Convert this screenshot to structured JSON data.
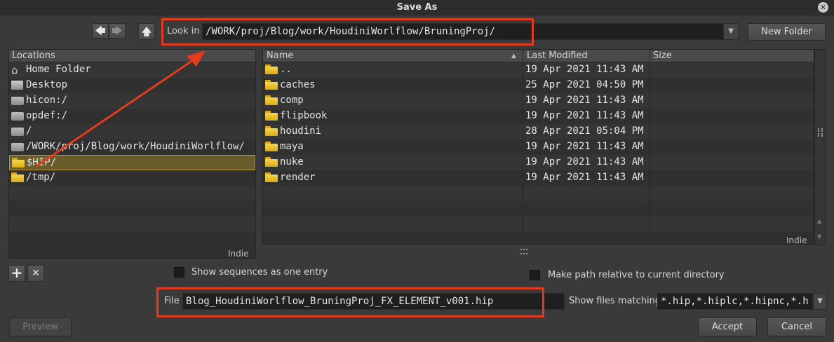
{
  "window": {
    "title": "Save As"
  },
  "toolbar": {
    "lookin_label": "Look in",
    "path": "/WORK/proj/Blog/work/HoudiniWorlflow/BruningProj/",
    "new_folder_label": "New Folder"
  },
  "locations": {
    "header": "Locations",
    "items": [
      {
        "label": "Home Folder",
        "icon": "home-icon"
      },
      {
        "label": "Desktop",
        "icon": "desktop-icon"
      },
      {
        "label": "hicon:/",
        "icon": "drive-icon"
      },
      {
        "label": "opdef:/",
        "icon": "drive-icon"
      },
      {
        "label": "/",
        "icon": "drive-icon"
      },
      {
        "label": "/WORK/proj/Blog/work/HoudiniWorlflow/",
        "icon": "drive-icon"
      },
      {
        "label": "$HIP/",
        "icon": "folder-icon",
        "selected": true
      },
      {
        "label": "/tmp/",
        "icon": "folder-icon"
      }
    ],
    "badge": "Indie"
  },
  "files": {
    "columns": {
      "name": "Name",
      "modified": "Last Modified",
      "size": "Size"
    },
    "rows": [
      {
        "name": "..",
        "modified": "19 Apr 2021 11:43 AM",
        "size": ""
      },
      {
        "name": "caches",
        "modified": "25 Apr 2021 04:50 PM",
        "size": ""
      },
      {
        "name": "comp",
        "modified": "19 Apr 2021 11:43 AM",
        "size": ""
      },
      {
        "name": "flipbook",
        "modified": "19 Apr 2021 11:43 AM",
        "size": ""
      },
      {
        "name": "houdini",
        "modified": "28 Apr 2021 05:04 PM",
        "size": ""
      },
      {
        "name": "maya",
        "modified": "19 Apr 2021 11:43 AM",
        "size": ""
      },
      {
        "name": "nuke",
        "modified": "19 Apr 2021 11:43 AM",
        "size": ""
      },
      {
        "name": "render",
        "modified": "19 Apr 2021 11:43 AM",
        "size": ""
      }
    ],
    "badge": "Indie"
  },
  "options": {
    "show_sequences": "Show sequences as one entry",
    "relative_path": "Make path relative to current directory"
  },
  "file": {
    "label": "File",
    "value": "Blog_HoudiniWorlflow_BruningProj_FX_ELEMENT_v001.hip",
    "match_label": "Show files matching",
    "match_value": "*.hip,*.hiplc,*.hipnc,*.h"
  },
  "buttons": {
    "preview": "Preview",
    "accept": "Accept",
    "cancel": "Cancel"
  },
  "colors": {
    "annotation": "#e23b1e",
    "folder": "#f0c93a",
    "selected": "#6a5b2a"
  }
}
